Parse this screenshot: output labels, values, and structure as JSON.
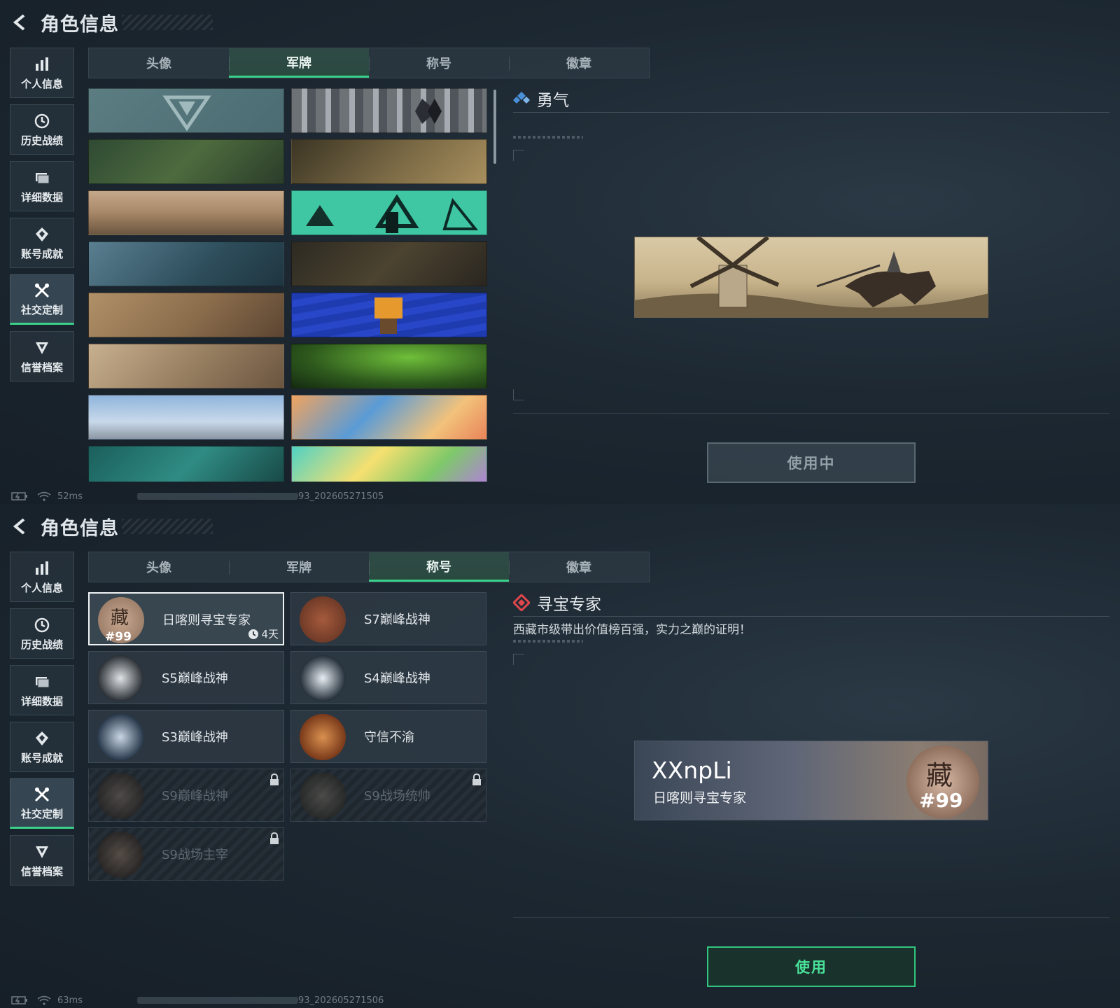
{
  "header": {
    "title": "角色信息"
  },
  "sidebar": {
    "items": [
      {
        "label": "个人信息",
        "icon": "bar-chart-icon"
      },
      {
        "label": "历史战绩",
        "icon": "clock-icon"
      },
      {
        "label": "详细数据",
        "icon": "folder-icon"
      },
      {
        "label": "账号成就",
        "icon": "achievement-icon"
      },
      {
        "label": "社交定制",
        "icon": "tools-icon",
        "active": true
      },
      {
        "label": "信誉档案",
        "icon": "shield-icon"
      }
    ]
  },
  "tabs": [
    "头像",
    "军牌",
    "称号",
    "徽章"
  ],
  "screen_a": {
    "active_tab": "军牌",
    "detail": {
      "title": "勇气",
      "button": "使用中"
    },
    "status": {
      "ping": "52ms",
      "build": "93_202605271505"
    }
  },
  "screen_b": {
    "active_tab": "称号",
    "titles": [
      {
        "name": "日喀则寻宝专家",
        "badge": "#99",
        "timer": "4天",
        "selected": true,
        "locked": false,
        "medal": "treasure-medal-icon"
      },
      {
        "name": "S7巅峰战神",
        "locked": false,
        "medal": "gun-medal-icon"
      },
      {
        "name": "S5巅峰战神",
        "locked": false,
        "medal": "skull-medal-icon"
      },
      {
        "name": "S4巅峰战神",
        "locked": false,
        "medal": "helmet-medal-icon"
      },
      {
        "name": "S3巅峰战神",
        "locked": false,
        "medal": "globe-medal-icon"
      },
      {
        "name": "守信不渝",
        "locked": false,
        "medal": "scales-medal-icon"
      },
      {
        "name": "S9巅峰战神",
        "locked": true,
        "medal": "building-medal-icon"
      },
      {
        "name": "S9战场统帅",
        "locked": true,
        "medal": "ship-medal-icon"
      },
      {
        "name": "S9战场主宰",
        "locked": true,
        "medal": "mushroom-cloud-medal-icon"
      }
    ],
    "detail": {
      "title": "寻宝专家",
      "description": "西藏市级带出价值榜百强，实力之巅的证明！",
      "preview_player": "XXnpLi",
      "preview_title": "日喀则寻宝专家",
      "preview_badge_char": "藏",
      "preview_badge_num": "#99",
      "button": "使用"
    },
    "status": {
      "ping": "63ms",
      "build": "93_202605271506"
    }
  },
  "colors": {
    "accent": "#39d08a",
    "diamond_blue": "#4a90d9",
    "diamond_red": "#e0474c"
  }
}
